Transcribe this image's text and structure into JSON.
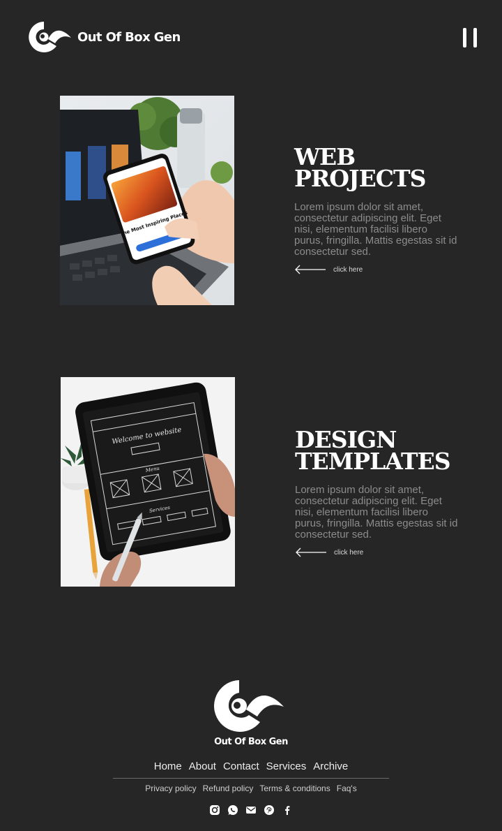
{
  "header": {
    "brand": "Out Of Box Gen",
    "logo_icon": "brand-logo-icon",
    "menu_icon": "menu-icon"
  },
  "projects": [
    {
      "title_line1": "WEB",
      "title_line2": "PROJECTS",
      "description": "Lorem ipsum dolor sit amet, consectetur adipiscing elit. Eget nisi, elementum facilisi libero purus, fringilla. Mattis egestas sit id consectetur sed.",
      "link_label": "click here",
      "link_icon": "arrow-left-icon",
      "image_name": "web-projects-photo",
      "image_text": {
        "title": "The Most Inspiring Places"
      }
    },
    {
      "title_line1": "DESIGN",
      "title_line2": "TEMPLATES",
      "description": "Lorem ipsum dolor sit amet, consectetur adipiscing elit. Eget nisi, elementum facilisi libero purus, fringilla. Mattis egestas sit id consectetur sed.",
      "link_label": "click here",
      "link_icon": "arrow-left-icon",
      "image_name": "design-templates-photo",
      "image_text": {
        "heading": "Welcome to website",
        "section_a": "Menu",
        "section_b": "Services"
      }
    }
  ],
  "footer": {
    "brand": "Out Of Box Gen",
    "nav": [
      "Home",
      "About",
      "Contact",
      "Services",
      "Archive"
    ],
    "legal": [
      "Privacy policy",
      "Refund policy",
      "Terms & conditions",
      "Faq's"
    ],
    "social": [
      "instagram-icon",
      "whatsapp-icon",
      "email-icon",
      "pinterest-icon",
      "facebook-icon"
    ]
  },
  "colors": {
    "background": "#262626",
    "text": "#ffffff",
    "muted": "#8c8c8c"
  }
}
